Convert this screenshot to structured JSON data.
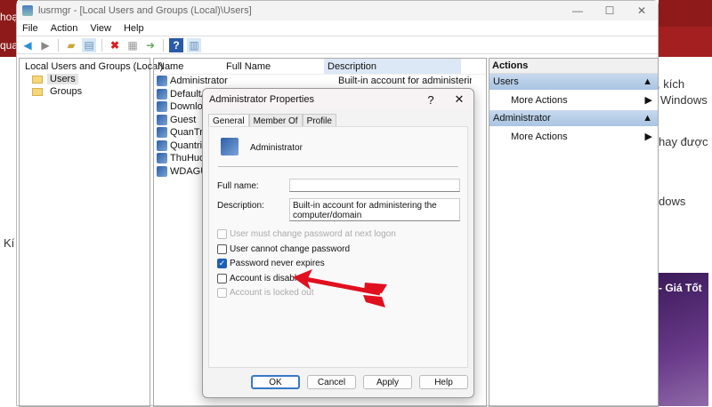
{
  "background": {
    "left_texts": [
      "hoạt",
      "quan"
    ],
    "left_bottom": "Kí",
    "right_texts": [
      ", kích",
      "Windows",
      "hay được",
      "dows"
    ],
    "ad_text": "- Giá Tốt"
  },
  "window": {
    "title": "lusrmgr - [Local Users and Groups (Local)\\Users]",
    "controls": [
      "—",
      "☐",
      "✕"
    ]
  },
  "menu": [
    "File",
    "Action",
    "View",
    "Help"
  ],
  "tree": {
    "root": "Local Users and Groups (Local)",
    "items": [
      "Users",
      "Groups"
    ]
  },
  "list": {
    "columns": [
      "Name",
      "Full Name",
      "Description"
    ],
    "rows": [
      {
        "name": "Administrator",
        "full": "",
        "desc": "Built-in account for administering..."
      },
      {
        "name": "DefaultAc",
        "full": "",
        "desc": ""
      },
      {
        "name": "Download",
        "full": "",
        "desc": ""
      },
      {
        "name": "Guest",
        "full": "",
        "desc": ""
      },
      {
        "name": "QuanTriM",
        "full": "",
        "desc": ""
      },
      {
        "name": "Quantrim",
        "full": "",
        "desc": ""
      },
      {
        "name": "ThuHuon",
        "full": "",
        "desc": ""
      },
      {
        "name": "WDAGUti",
        "full": "",
        "desc": ""
      }
    ]
  },
  "actions": {
    "title": "Actions",
    "sections": [
      {
        "label": "Users",
        "item": "More Actions"
      },
      {
        "label": "Administrator",
        "item": "More Actions"
      }
    ]
  },
  "dialog": {
    "title": "Administrator Properties",
    "help": "?",
    "close": "✕",
    "tabs": [
      "General",
      "Member Of",
      "Profile"
    ],
    "username": "Administrator",
    "full_name_label": "Full name:",
    "full_name_value": "",
    "description_label": "Description:",
    "description_value": "Built-in account for administering the computer/domain",
    "checkboxes": [
      {
        "label": "User must change password at next logon",
        "checked": false,
        "disabled": true
      },
      {
        "label": "User cannot change password",
        "checked": false,
        "disabled": false
      },
      {
        "label": "Password never expires",
        "checked": true,
        "disabled": false
      },
      {
        "label": "Account is disabled",
        "checked": false,
        "disabled": false
      },
      {
        "label": "Account is locked out",
        "checked": false,
        "disabled": true
      }
    ],
    "buttons": [
      "OK",
      "Cancel",
      "Apply",
      "Help"
    ]
  },
  "colors": {
    "arrow": "#e0101e",
    "accent": "#1d5fb5"
  }
}
